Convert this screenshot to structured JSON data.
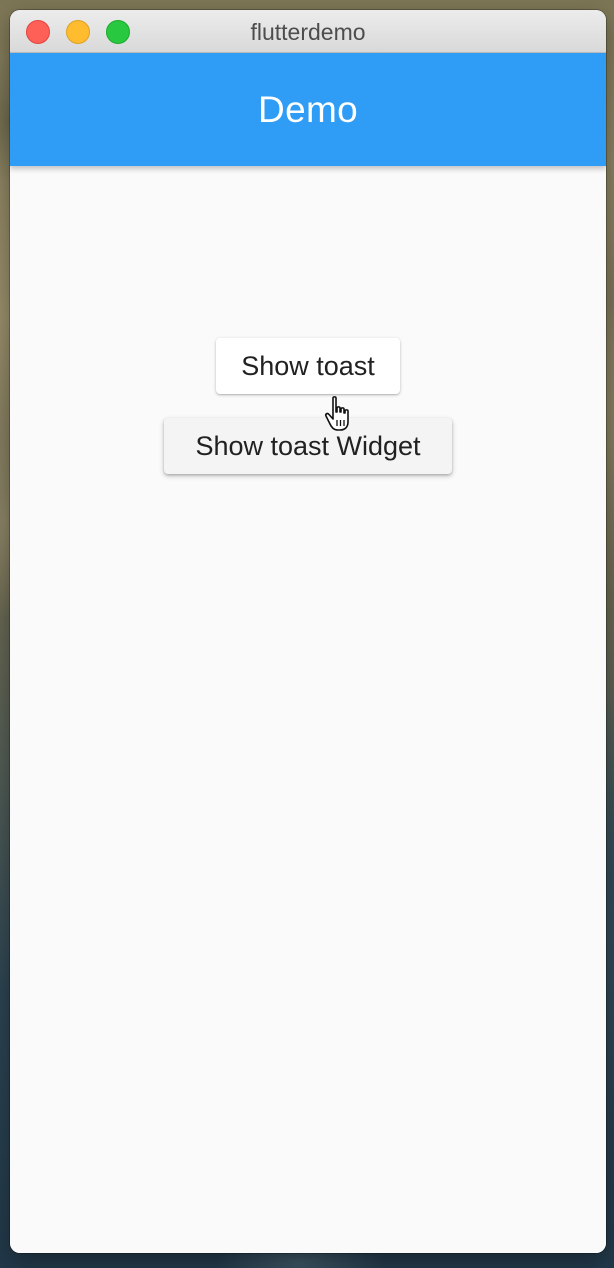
{
  "window": {
    "title": "flutterdemo",
    "controls": [
      "close",
      "minimize",
      "maximize"
    ]
  },
  "appbar": {
    "title": "Demo",
    "color": "#2f9cf6"
  },
  "buttons": {
    "show_toast": "Show toast",
    "show_toast_widget": "Show toast Widget"
  },
  "cursor": {
    "icon": "pointer-hand-icon"
  }
}
